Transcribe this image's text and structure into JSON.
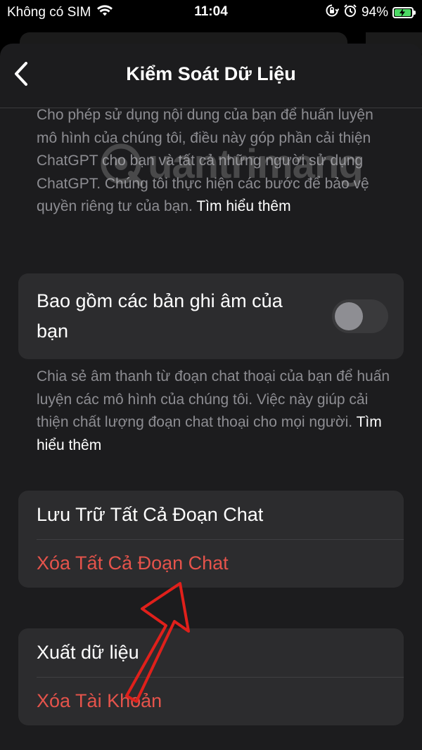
{
  "status_bar": {
    "carrier": "Không có SIM",
    "time": "11:04",
    "battery": "94%"
  },
  "nav": {
    "title": "Kiểm Soát Dữ Liệu"
  },
  "training_description": {
    "text": "Cho phép sử dụng nội dung của bạn để huấn luyện mô hình của chúng tôi, điều này góp phần cải thiện ChatGPT cho bạn và tất cả những người sử dụng ChatGPT. Chúng tôi thực hiện các bước để bảo vệ quyền riêng tư của bạn.",
    "link": "Tìm hiểu thêm"
  },
  "voice_setting": {
    "label": "Bao gồm các bản ghi âm của bạn",
    "enabled": false
  },
  "voice_description": {
    "text": "Chia sẻ âm thanh từ đoạn chat thoại của bạn để huấn luyện các mô hình của chúng tôi. Việc này giúp cải thiện chất lượng đoạn chat thoại cho mọi người.",
    "link": "Tìm hiểu thêm"
  },
  "chat_group": {
    "archive_all": "Lưu Trữ Tất Cả Đoạn Chat",
    "delete_all": "Xóa Tất Cả Đoạn Chat"
  },
  "account_group": {
    "export_data": "Xuất dữ liệu",
    "delete_account": "Xóa Tài Khoản"
  },
  "watermark": {
    "text": "uantrimang"
  },
  "colors": {
    "background": "#000000",
    "sheet": "#1c1c1e",
    "card": "#2c2c2e",
    "danger": "#e5534b",
    "secondary_text": "#8d8d92",
    "annotation_arrow": "#e0201b"
  },
  "icons": {
    "back": "chevron-left-icon",
    "wifi": "wifi-icon",
    "orientation_lock": "rotation-lock-icon",
    "alarm": "alarm-clock-icon",
    "battery": "battery-charging-icon"
  }
}
